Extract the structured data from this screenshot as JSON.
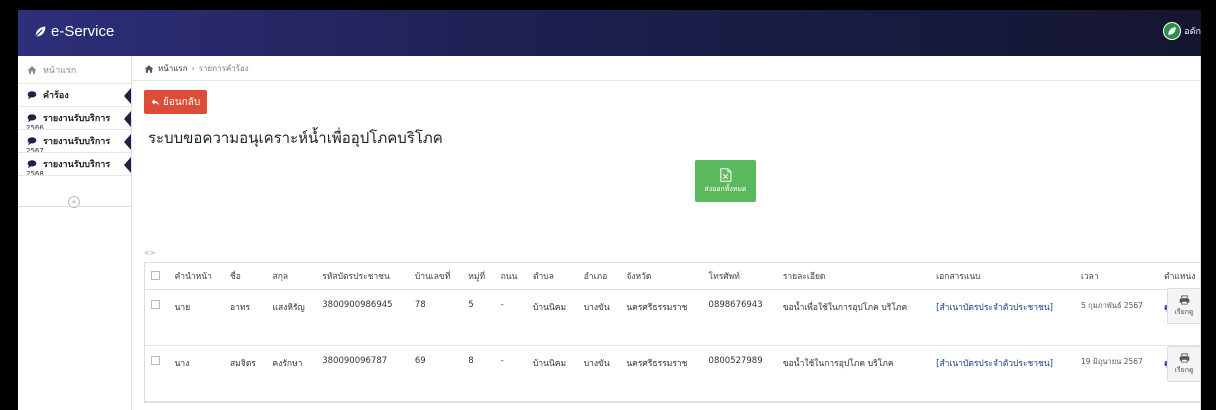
{
  "app": {
    "title": "e-Service",
    "user_label": "อดัก"
  },
  "sidebar": {
    "home": "หน้าแรก",
    "items": [
      {
        "label": "คำร้อง",
        "sub": ""
      },
      {
        "label": "รายงานรับบริการ",
        "sub": "2566"
      },
      {
        "label": "รายงานรับบริการ",
        "sub": "2567"
      },
      {
        "label": "รายงานรับบริการ",
        "sub": "2568"
      }
    ],
    "collapse": "«"
  },
  "breadcrumb": {
    "home": "หน้าแรก",
    "sep": "›",
    "current": "รายการคำร้อง"
  },
  "back_button": "ย้อนกลับ",
  "page_title": "ระบบขอความอนุเคราะห์น้ำเพื่ออุปโภคบริโภค",
  "export_button": "ส่งออกทั้งหมด",
  "toggle_mark": "<>",
  "table": {
    "headers": [
      "คำนำหน้า",
      "ชื่อ",
      "สกุล",
      "รหัสบัตรประชาชน",
      "บ้านเลขที่",
      "หมู่ที่",
      "ถนน",
      "ตำบล",
      "อำเภอ",
      "จังหวัด",
      "โทรศัพท์",
      "รายละเอียด",
      "เอกสารแนบ",
      "เวลา",
      "ตำแหน่ง"
    ],
    "rows": [
      {
        "prefix": "นาย",
        "first": "อาทร",
        "last": "แสงหิรัญ",
        "id": "3800900986945",
        "house": "78",
        "moo": "5",
        "road": "-",
        "tambon": "บ้านนิคม",
        "amphoe": "บางขัน",
        "province": "นครศรีธรรมราช",
        "phone": "0898676943",
        "detail": "ขอน้ำเพื่อใช้ในการอุปโภค บริโภค",
        "attach": "[สำเนาบัตรประจำตัวประชาชน]",
        "time": "5 กุมภาพันธ์ 2567",
        "location": "ดูแผนที่",
        "print": "เรียกดู"
      },
      {
        "prefix": "นาง",
        "first": "สมจิตร",
        "last": "คงรักษา",
        "id": "380090096787",
        "house": "69",
        "moo": "8",
        "road": "-",
        "tambon": "บ้านนิคม",
        "amphoe": "บางขัน",
        "province": "นครศรีธรรมราช",
        "phone": "0800527989",
        "detail": "ขอน้ำใช้ในการอุปโภค บริโภค",
        "attach": "[สำเนาบัตรประจำตัวประชาชน]",
        "time": "19 มิถุนายน 2567",
        "location": "ดูแผนที่",
        "print": "เรียกดู"
      }
    ]
  },
  "colors": {
    "topbar": "#1d1f4f",
    "back_button": "#dd4b39",
    "export_button": "#5cb85c",
    "sidebar_notch": "#1f2247"
  },
  "icons": {
    "brand": "leaf-icon",
    "home": "home-icon",
    "comment": "comment-icon",
    "back": "reply-arrow-icon",
    "excel": "excel-file-icon",
    "print": "printer-icon"
  }
}
